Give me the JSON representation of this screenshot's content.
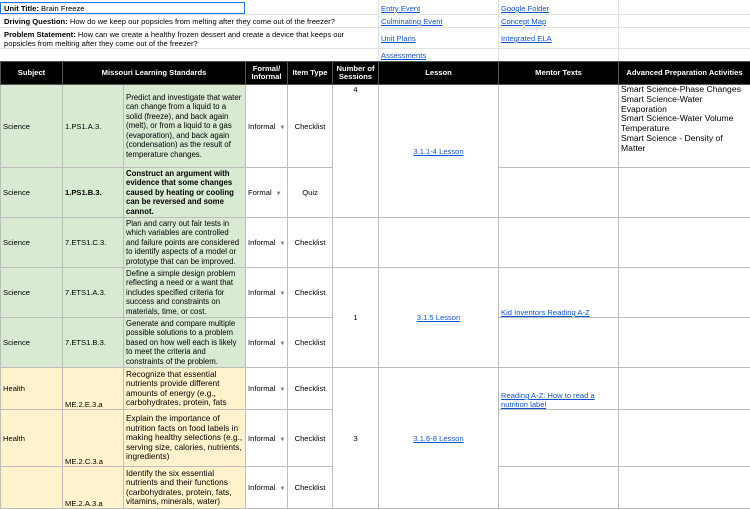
{
  "header": {
    "unit_title_label": "Unit Title:",
    "unit_title_value": "Brain Freeze",
    "driving_question_label": "Driving Question:",
    "driving_question_value": "How do we keep our popsicles from melting after they come out of the freezer?",
    "problem_statement_label": "Problem Statement:",
    "problem_statement_value": "How can we create a healthy frozen dessert and create a device that keeps our popsicles from melting after they come out of the freezer?",
    "links": {
      "entry_event": "Entry Event",
      "culminating_event": "Culminating Event",
      "unit_plans": "Unit Plans",
      "assessments": "Assessments",
      "google_folder": "Google Folder",
      "concept_map": "Concept Map",
      "integrated_ela": "Integrated ELA"
    }
  },
  "columns": [
    "Subject",
    "Missouri Learning Standards",
    "Formal/ Informal",
    "Item Type",
    "Number of Sessions",
    "Lesson",
    "Mentor Texts",
    "Advanced Preparation Activities"
  ],
  "rows": [
    {
      "subject": "Science",
      "code": "1.PS1.A.3.",
      "standard": "Predict and investigate that water can change from a liquid to a solid (freeze), and back again (melt), or from a liquid to a gas (evaporation), and back again (condensation) as the result of temperature changes.",
      "formal": "Informal",
      "item_type": "Checklist"
    },
    {
      "subject": "Science",
      "code": "1.PS1.B.3.",
      "standard": "Construct an argument with evidence that some changes caused by heating or cooling can be reversed and some cannot.",
      "formal": "Formal",
      "item_type": "Quiz"
    },
    {
      "subject": "Science",
      "code": "7.ETS1.C.3.",
      "standard": "Plan and carry out fair tests in which variables are controlled and failure points are considered to identify aspects of a model or prototype that can be improved.",
      "formal": "Informal",
      "item_type": "Checklist"
    },
    {
      "subject": "Science",
      "code": "7.ETS1.A.3.",
      "standard": "Define a simple design problem reflecting a need or a want that includes specified criteria for success and constraints on materials, time, or cost.",
      "formal": "Informal",
      "item_type": "Checklist"
    },
    {
      "subject": "Science",
      "code": "7.ETS1.B.3.",
      "standard": "Generate and compare multiple possible solutions to a problem based on how well each is likely to meet the criteria and constraints of the problem.",
      "formal": "Informal",
      "item_type": "Checklist"
    },
    {
      "subject": "Health",
      "code": "ME.2.E.3.a",
      "standard": "Recognize that essential nutrients provide different amounts of energy (e.g., carbohydrates, protein, fats",
      "formal": "Informal",
      "item_type": "Checklist"
    },
    {
      "subject": "Health",
      "code": "ME.2.C.3.a",
      "standard": "Explain the importance of nutrition facts on food labels in making healthy selections (e.g., serving size, calories, nutrients, ingredients)",
      "formal": "Informal",
      "item_type": "Checklist"
    },
    {
      "subject": "",
      "code": "ME.2.A.3.a",
      "standard": "Identify the six essential nutrients and their functions (carbohydrates, protein, fats, vitamins, minerals, water)",
      "formal": "Informal",
      "item_type": "Checklist"
    }
  ],
  "groups": [
    {
      "sessions": "4",
      "lesson": "3.1.1-4 Lesson"
    },
    {
      "sessions": "1",
      "lesson": "3.1.5 Lesson",
      "mentor": "Kid Inventors Reading A-Z"
    },
    {
      "sessions": "3",
      "lesson": "3.1.6-8 Lesson",
      "mentor": "Reading A-Z: How to read a nutrition label"
    }
  ],
  "advanced": [
    "Smart Science-Phase Changes",
    "Smart Science-Water Evaporation",
    "Smart Science-Water Volume Temperature",
    "Smart Science - Density of Matter"
  ]
}
